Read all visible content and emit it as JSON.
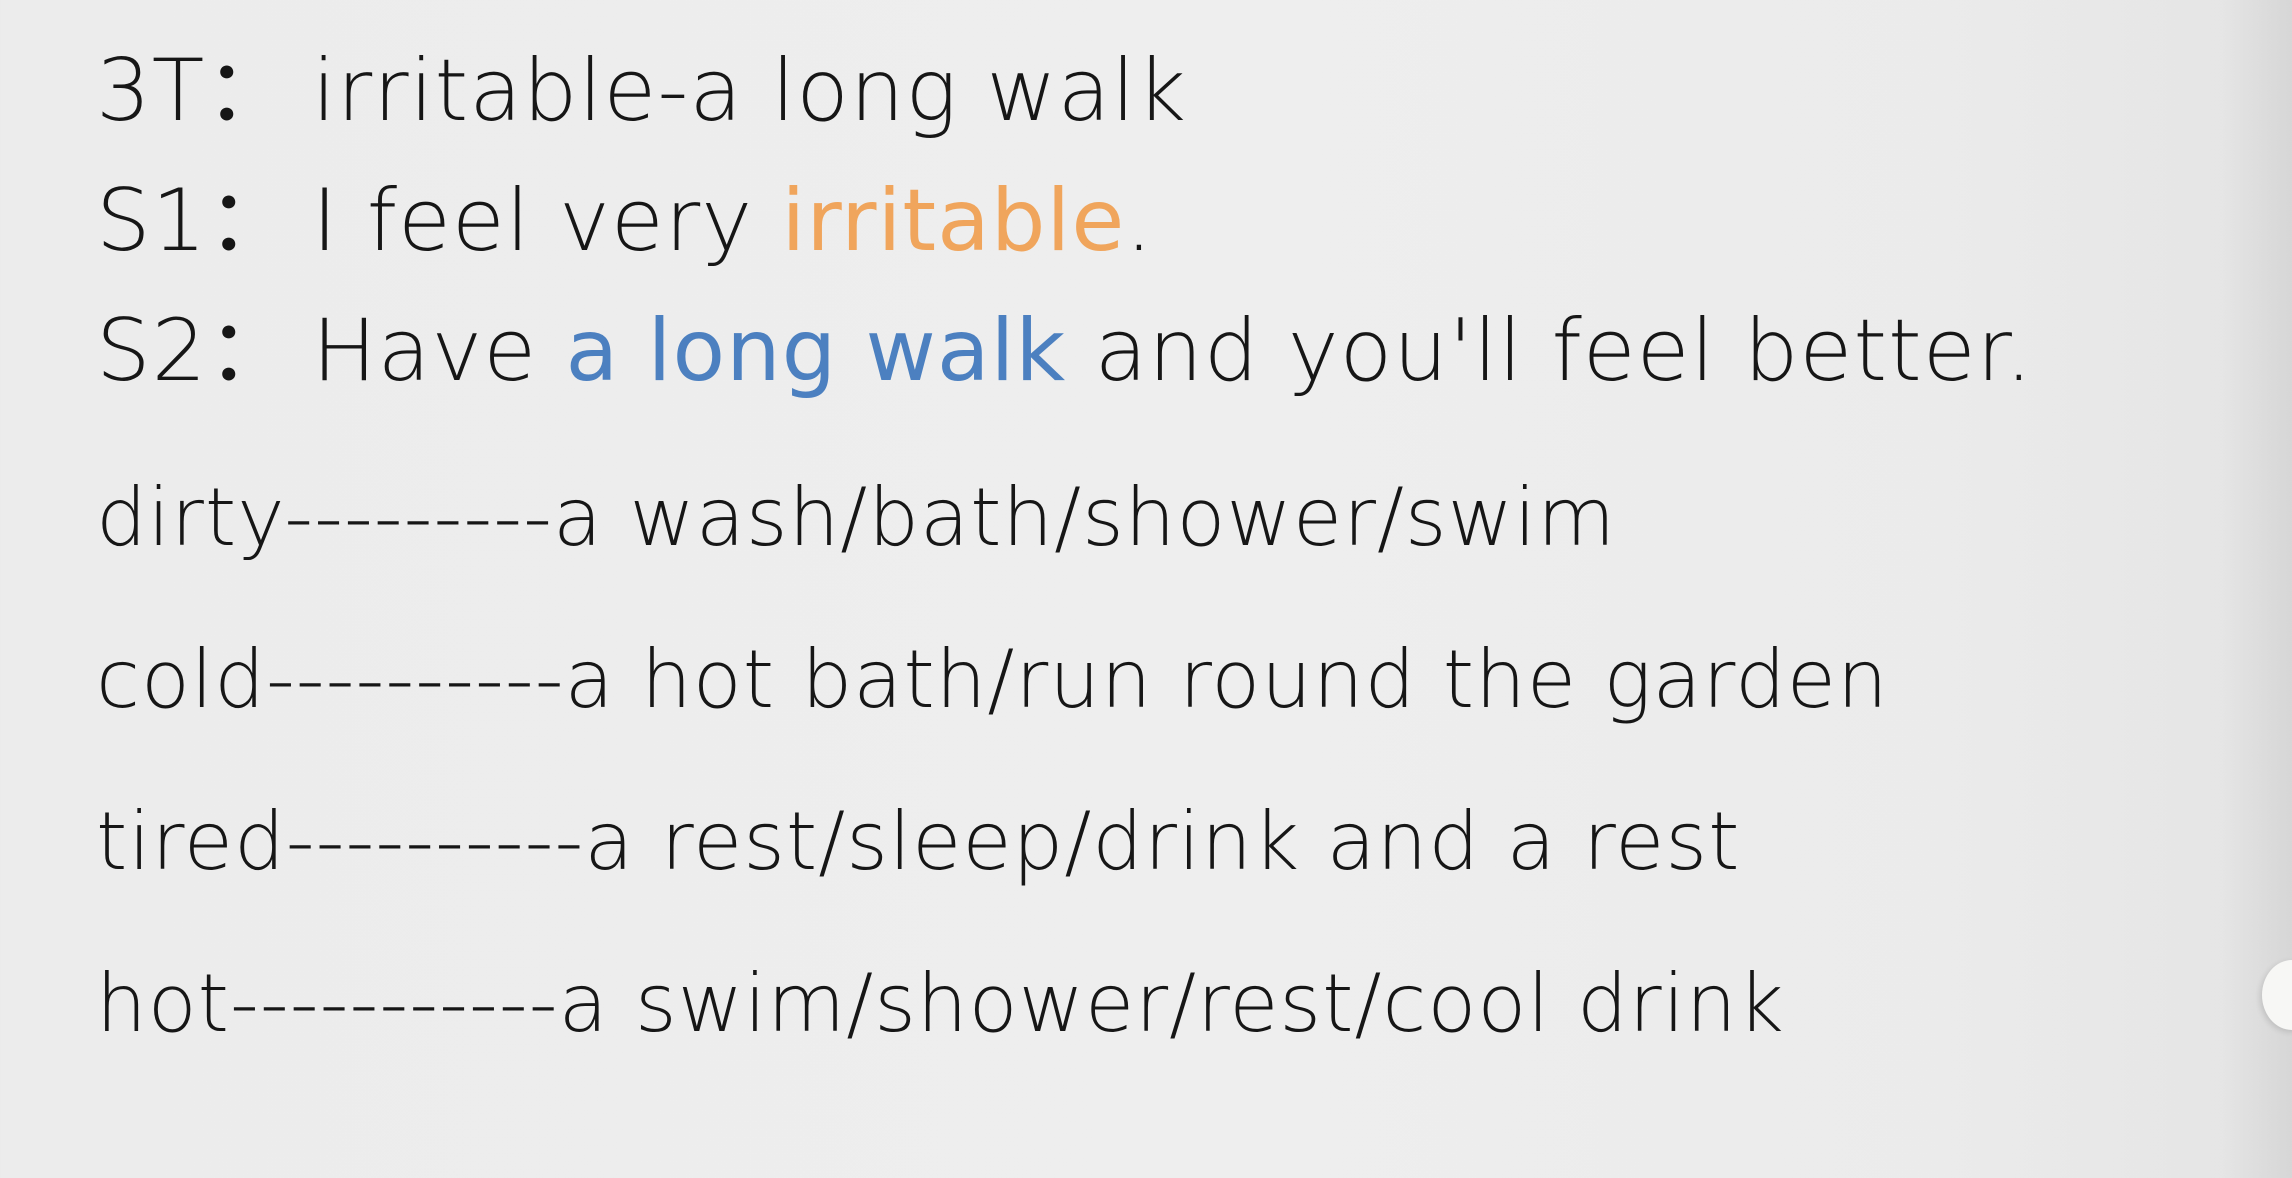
{
  "dialogue": [
    {
      "speaker": "3T：",
      "segments": [
        {
          "text": "irritable-a long walk",
          "style": "plain"
        }
      ]
    },
    {
      "speaker": "S1：",
      "segments": [
        {
          "text": "I feel very ",
          "style": "plain"
        },
        {
          "text": "irritable",
          "style": "orange"
        },
        {
          "text": ".",
          "style": "plain"
        }
      ]
    },
    {
      "speaker": "S2：",
      "segments": [
        {
          "text": "Have ",
          "style": "plain"
        },
        {
          "text": "a long walk",
          "style": "blue"
        },
        {
          "text": " and you'll feel better.",
          "style": "plain"
        }
      ]
    }
  ],
  "pairs": [
    {
      "feeling": "dirty",
      "dashes": "---------",
      "remedies": "a wash/bath/shower/swim"
    },
    {
      "feeling": "cold",
      "dashes": "----------",
      "remedies": "a hot bath/run round the garden"
    },
    {
      "feeling": "tired",
      "dashes": "----------",
      "remedies": "a rest/sleep/drink and a rest"
    },
    {
      "feeling": "hot",
      "dashes": "-----------",
      "remedies": "a swim/shower/rest/cool drink"
    }
  ],
  "colors": {
    "text": "#161616",
    "highlight_orange": "#f0a55c",
    "highlight_blue": "#4c80c0",
    "background": "#ededed"
  }
}
